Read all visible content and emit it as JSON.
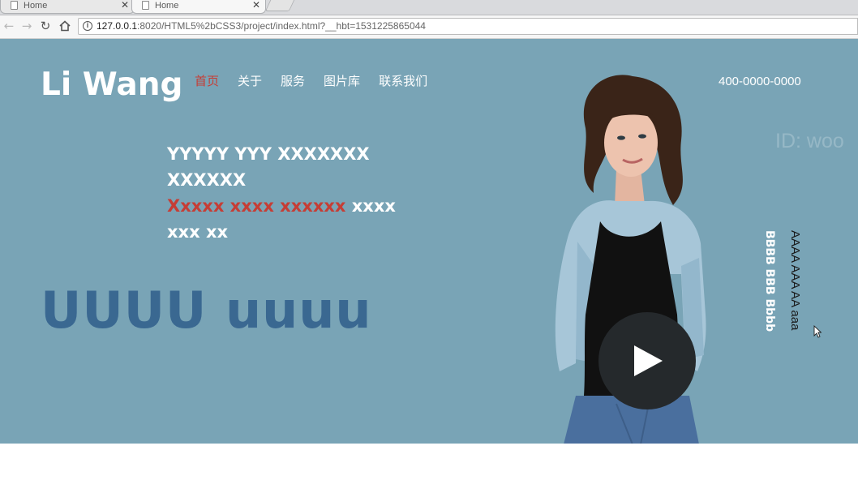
{
  "browser": {
    "tabs": [
      {
        "title": "Home"
      },
      {
        "title": "Home"
      }
    ],
    "url_host": "127.0.0.1",
    "url_rest": ":8020/HTML5%2bCSS3/project/index.html?__hbt=1531225865044"
  },
  "site": {
    "logo": "Li Wang",
    "nav": [
      "首页",
      "关于",
      "服务",
      "图片库",
      "联系我们"
    ],
    "phone": "400-0000-0000",
    "watermark": "ID: woo",
    "headline": {
      "line1": "YYYYY YYY XXXXXXX XXXXXX",
      "red": "Xxxxx xxxx xxxxxx",
      "tail": "xxxx xxx xx"
    },
    "big_title": "UUUU uuuu",
    "vertical_bold": "BBBB BBB Bbbb",
    "vertical_light": "AAAA AAA AA aaa"
  },
  "colors": {
    "hero_bg": "#79a4b6",
    "accent_red": "#c63d35",
    "title_blue": "#3a6891",
    "play_bg": "#25292c"
  },
  "icons": [
    "page-icon",
    "close-icon",
    "back-icon",
    "forward-icon",
    "reload-icon",
    "home-icon",
    "info-icon",
    "play-icon"
  ]
}
